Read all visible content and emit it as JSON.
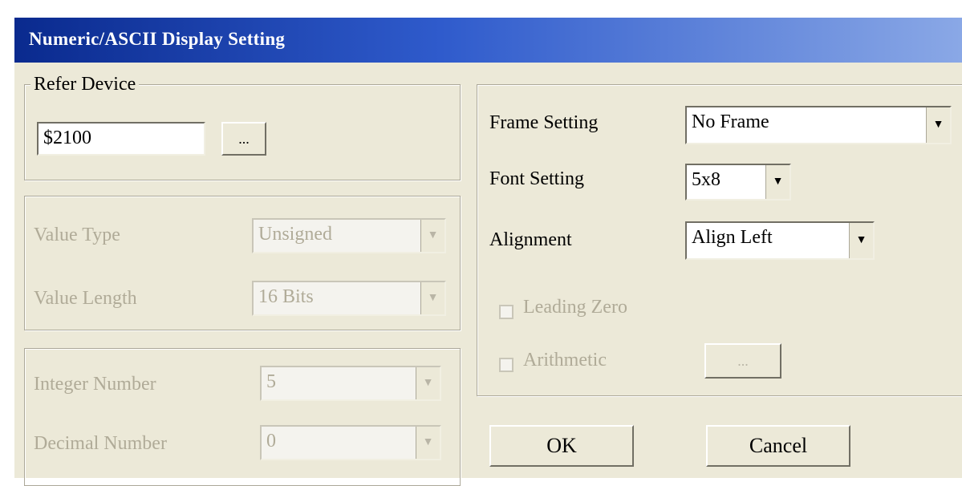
{
  "window": {
    "title": "Numeric/ASCII Display Setting"
  },
  "refer_device": {
    "legend": "Refer Device",
    "value": "$2100",
    "browse_label": "..."
  },
  "value_group": {
    "type_label": "Value Type",
    "type_value": "Unsigned",
    "length_label": "Value Length",
    "length_value": "16 Bits"
  },
  "number_group": {
    "integer_label": "Integer Number",
    "integer_value": "5",
    "decimal_label": "Decimal Number",
    "decimal_value": "0"
  },
  "display_group": {
    "frame_label": "Frame Setting",
    "frame_value": "No Frame",
    "font_label": "Font Setting",
    "font_value": "5x8",
    "alignment_label": "Alignment",
    "alignment_value": "Align Left",
    "leading_zero_label": "Leading Zero",
    "arithmetic_label": "Arithmetic",
    "arithmetic_button": "..."
  },
  "buttons": {
    "ok": "OK",
    "cancel": "Cancel"
  },
  "icons": {
    "dropdown": "chevron-down-icon"
  },
  "colors": {
    "title_start": "#0a2a8e",
    "title_end": "#8aa8e6",
    "dialog_bg": "#ece9d8",
    "disabled_text": "#b0ab98"
  }
}
